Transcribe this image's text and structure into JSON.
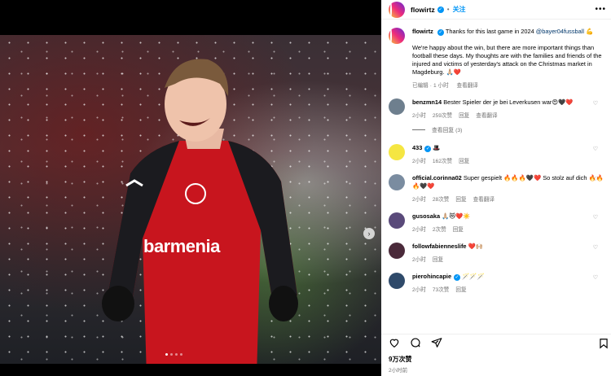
{
  "post": {
    "username": "flowirtz",
    "follow_label": "关注",
    "separator": "•",
    "more_label": "•••",
    "caption_line1_pre": "Thanks for this last game in 2024 ",
    "caption_mention": "@bayer04fussball",
    "caption_line1_emoji": " 💪",
    "caption_body": "We're happy about the win, but there are more important things than football these days. My thoughts are with the families and friends of the injured and victims of yesterday's attack on the Christmas market in Magdeburg. 🙏🏼❤️",
    "caption_edited": "已编辑",
    "caption_dot": "·",
    "caption_time": "1 小时",
    "caption_translate": "查看翻译",
    "shirt_sponsor": "barmenia",
    "likes": "9万次赞",
    "posted_time": "2小时前"
  },
  "comments": [
    {
      "user": "benzmn14",
      "text": "Bester Spieler der je bei Leverkusen war😍🖤❤️",
      "time": "2小时",
      "likes": "259次赞",
      "reply": "回复",
      "translate": "查看翻译",
      "avatar": "#6e7f8e"
    },
    {
      "user": "433",
      "verified": true,
      "text": "🎩",
      "time": "2小时",
      "likes": "162次赞",
      "reply": "回复",
      "avatar": "#f5e642"
    },
    {
      "user": "official.corinna02",
      "text": "Super gespielt 🔥🔥🔥🖤❤️ So stolz auf dich 🔥🔥🔥🖤❤️",
      "time": "2小时",
      "likes": "28次赞",
      "reply": "回复",
      "translate": "查看翻译",
      "avatar": "#7a8ca0"
    },
    {
      "user": "gusosaka",
      "text": "🙏🏼😻❤️☀️",
      "time": "2小时",
      "likes": "2次赞",
      "reply": "回复",
      "avatar": "#5a4a7a"
    },
    {
      "user": "followfabienneslife",
      "text": "❤️🙌🏼",
      "time": "2小时",
      "reply": "回复",
      "avatar": "#4a2a3a"
    },
    {
      "user": "pierohincapie",
      "verified": true,
      "text": "🪄🪄🪄",
      "time": "2小时",
      "likes": "73次赞",
      "reply": "回复",
      "avatar": "#2f4a6a"
    }
  ],
  "view_replies": "查看回复 (3)",
  "icons": {
    "heart": "heart-icon",
    "comment": "comment-icon",
    "share": "share-icon",
    "bookmark": "bookmark-icon"
  }
}
